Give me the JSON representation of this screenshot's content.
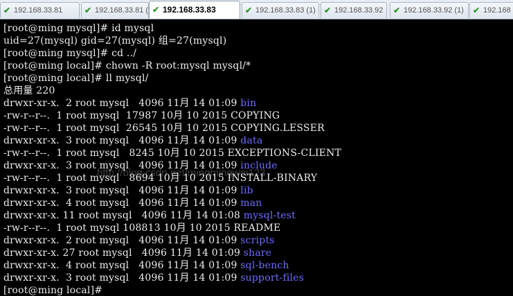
{
  "tabs": [
    {
      "label": "192.168.33.81",
      "active": false
    },
    {
      "label": "192.168.33.81 (1)",
      "active": false
    },
    {
      "label": "192.168.33.83",
      "active": true
    },
    {
      "label": "192.168.33.83 (1)",
      "active": false
    },
    {
      "label": "192.168.33.92",
      "active": false
    },
    {
      "label": "192.168.33.92 (1)",
      "active": false
    },
    {
      "label": "192.168",
      "active": false
    }
  ],
  "icons": {
    "tab_status": "check-icon",
    "tab_close": "close-icon"
  },
  "colors": {
    "terminal_bg": "#000000",
    "terminal_fg": "#ededed",
    "directory": "#6d6dff",
    "tab_check": "#2f9a2f"
  },
  "terminal": {
    "lines": [
      {
        "text": "[root@ming mysql]# id mysql"
      },
      {
        "text": "uid=27(mysql) gid=27(mysql) 组=27(mysql)"
      },
      {
        "text": "[root@ming mysql]# cd ../"
      },
      {
        "text": "[root@ming local]# chown -R root:mysql mysql/*"
      },
      {
        "text": "[root@ming local]# ll mysql/"
      },
      {
        "text": "总用量 220"
      },
      {
        "text": "drwxr-xr-x.  2 root mysql   4096 11月 14 01:09 ",
        "name": "bin"
      },
      {
        "text": "-rw-r--r--.  1 root mysql  17987 10月 10 2015 ",
        "name": "COPYING",
        "plain": true
      },
      {
        "text": "-rw-r--r--.  1 root mysql  26545 10月 10 2015 ",
        "name": "COPYING.LESSER",
        "plain": true
      },
      {
        "text": "drwxr-xr-x.  3 root mysql   4096 11月 14 01:09 ",
        "name": "data"
      },
      {
        "text": "-rw-r--r--.  1 root mysql   8245 10月 10 2015 ",
        "name": "EXCEPTIONS-CLIENT",
        "plain": true
      },
      {
        "text": "drwxr-xr-x.  3 root mysql   4096 11月 14 01:09 ",
        "name": "include"
      },
      {
        "text": "-rw-r--r--.  1 root mysql   8694 10月 10 2015 ",
        "name": "INSTALL-BINARY",
        "plain": true
      },
      {
        "text": "drwxr-xr-x.  3 root mysql   4096 11月 14 01:09 ",
        "name": "lib"
      },
      {
        "text": "drwxr-xr-x.  4 root mysql   4096 11月 14 01:09 ",
        "name": "man"
      },
      {
        "text": "drwxr-xr-x. 11 root mysql   4096 11月 14 01:08 ",
        "name": "mysql-test"
      },
      {
        "text": "-rw-r--r--.  1 root mysql 108813 10月 10 2015 ",
        "name": "README",
        "plain": true
      },
      {
        "text": "drwxr-xr-x.  2 root mysql   4096 11月 14 01:09 ",
        "name": "scripts"
      },
      {
        "text": "drwxr-xr-x. 27 root mysql   4096 11月 14 01:09 ",
        "name": "share"
      },
      {
        "text": "drwxr-xr-x.  4 root mysql   4096 11月 14 01:09 ",
        "name": "sql-bench"
      },
      {
        "text": "drwxr-xr-x.  3 root mysql   4096 11月 14 01:09 ",
        "name": "support-files"
      },
      {
        "text": "[root@ming local]# "
      }
    ]
  },
  "watermark": "http://blog.csdn.net/mingmingwei123"
}
